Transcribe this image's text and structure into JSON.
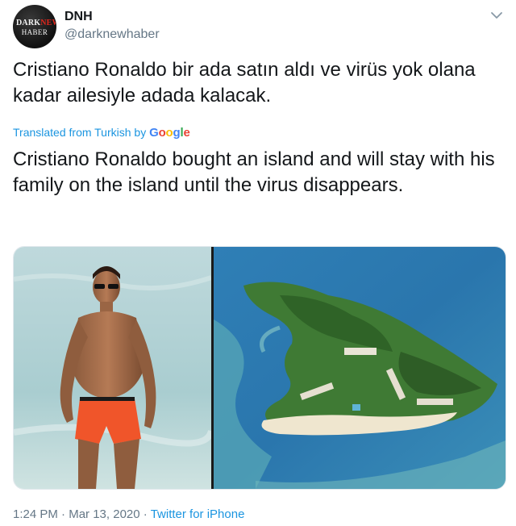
{
  "account": {
    "display_name": "DNH",
    "handle": "@darknewhaber",
    "avatar_logo": {
      "word1": "DARK",
      "word2": "NEW",
      "word3": "HABER"
    }
  },
  "tweet": {
    "text_original": "Cristiano Ronaldo bir ada satın aldı ve virüs yok olana kadar ailesiyle adada kalacak.",
    "translation_label": "Translated from Turkish by",
    "translation_provider": "Google",
    "text_translated": "Cristiano Ronaldo bought an island and will stay with his family on the island until the virus disappears.",
    "time": "1:24 PM",
    "date": "Mar 13, 2020",
    "separator": "·",
    "source": "Twitter for iPhone"
  },
  "colors": {
    "link": "#1b95e0",
    "secondary_text": "#657786",
    "google": [
      "#4285f4",
      "#ea4335",
      "#fbbc05",
      "#4285f4",
      "#34a853",
      "#ea4335"
    ]
  },
  "icons": {
    "menu": "chevron-down-icon"
  }
}
